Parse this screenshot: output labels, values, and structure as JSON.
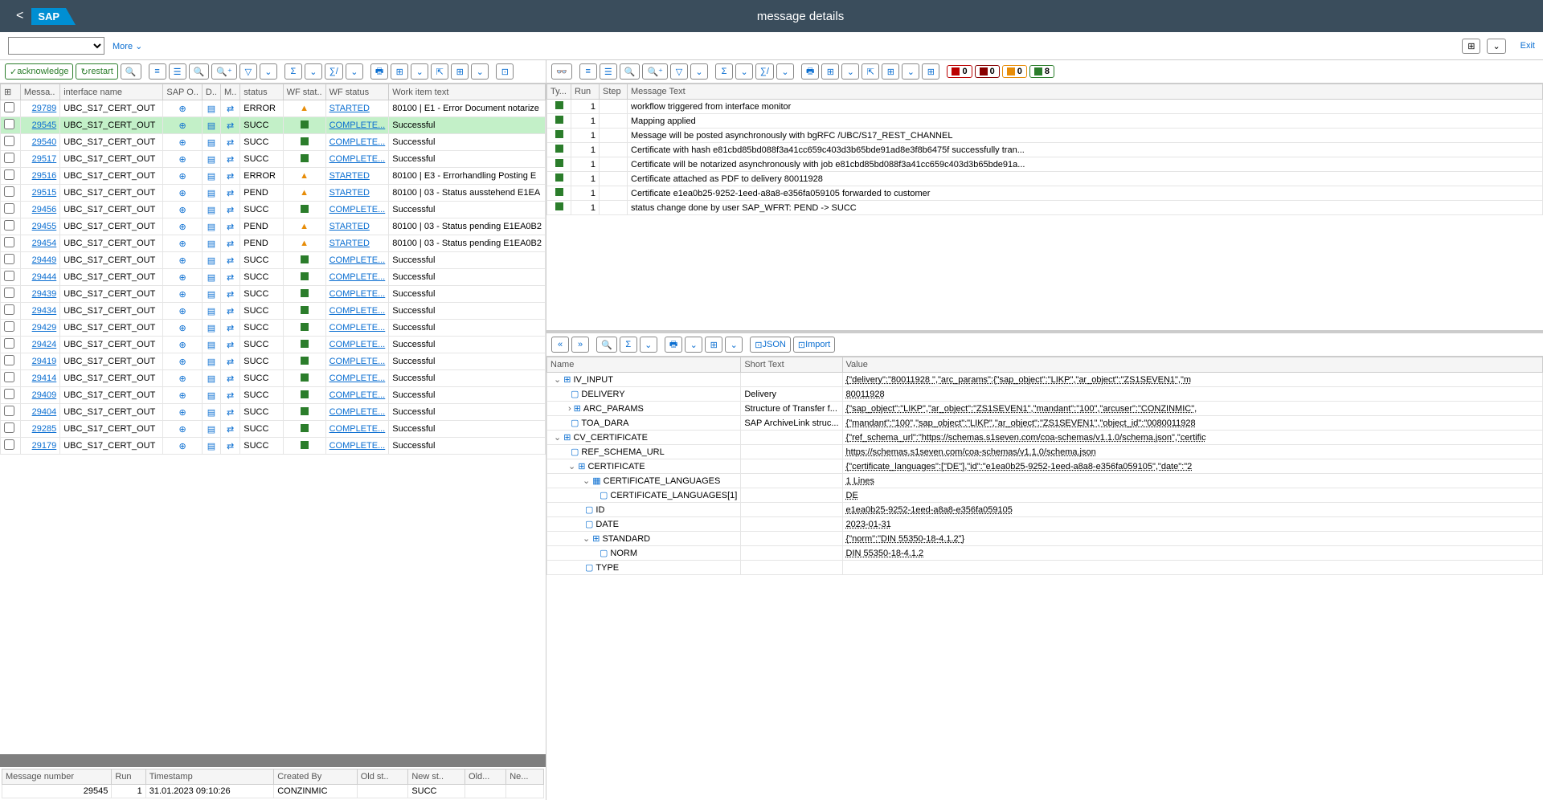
{
  "header": {
    "title": "message details",
    "sap": "SAP",
    "more": "More",
    "exit": "Exit"
  },
  "tb": {
    "ack": "acknowledge",
    "restart": "restart",
    "json": "JSON",
    "import": "Import"
  },
  "badges": {
    "r": "0",
    "dr": "0",
    "o": "0",
    "g": "8"
  },
  "cols_left": [
    "",
    "Messa..",
    "interface name",
    "SAP O..",
    "D..",
    "M..",
    "status",
    "WF stat..",
    "WF status",
    "Work item text"
  ],
  "rows": [
    {
      "id": "29789",
      "if": "UBC_S17_CERT_OUT",
      "st": "ERROR",
      "wfi": "o",
      "wf": "STARTED",
      "txt": "80100 | E1 - Error Document notarize"
    },
    {
      "id": "29545",
      "if": "UBC_S17_CERT_OUT",
      "st": "SUCC",
      "wfi": "g",
      "wf": "COMPLETE...",
      "txt": "Successful",
      "sel": true
    },
    {
      "id": "29540",
      "if": "UBC_S17_CERT_OUT",
      "st": "SUCC",
      "wfi": "g",
      "wf": "COMPLETE...",
      "txt": "Successful"
    },
    {
      "id": "29517",
      "if": "UBC_S17_CERT_OUT",
      "st": "SUCC",
      "wfi": "g",
      "wf": "COMPLETE...",
      "txt": "Successful"
    },
    {
      "id": "29516",
      "if": "UBC_S17_CERT_OUT",
      "st": "ERROR",
      "wfi": "o",
      "wf": "STARTED",
      "txt": "80100 | E3 - Errorhandling Posting E"
    },
    {
      "id": "29515",
      "if": "UBC_S17_CERT_OUT",
      "st": "PEND",
      "wfi": "o",
      "wf": "STARTED",
      "txt": "80100 | 03 - Status ausstehend E1EA"
    },
    {
      "id": "29456",
      "if": "UBC_S17_CERT_OUT",
      "st": "SUCC",
      "wfi": "g",
      "wf": "COMPLETE...",
      "txt": "Successful"
    },
    {
      "id": "29455",
      "if": "UBC_S17_CERT_OUT",
      "st": "PEND",
      "wfi": "o",
      "wf": "STARTED",
      "txt": "80100 | 03 - Status pending E1EA0B2"
    },
    {
      "id": "29454",
      "if": "UBC_S17_CERT_OUT",
      "st": "PEND",
      "wfi": "o",
      "wf": "STARTED",
      "txt": "80100 | 03 - Status pending E1EA0B2"
    },
    {
      "id": "29449",
      "if": "UBC_S17_CERT_OUT",
      "st": "SUCC",
      "wfi": "g",
      "wf": "COMPLETE...",
      "txt": "Successful"
    },
    {
      "id": "29444",
      "if": "UBC_S17_CERT_OUT",
      "st": "SUCC",
      "wfi": "g",
      "wf": "COMPLETE...",
      "txt": "Successful"
    },
    {
      "id": "29439",
      "if": "UBC_S17_CERT_OUT",
      "st": "SUCC",
      "wfi": "g",
      "wf": "COMPLETE...",
      "txt": "Successful"
    },
    {
      "id": "29434",
      "if": "UBC_S17_CERT_OUT",
      "st": "SUCC",
      "wfi": "g",
      "wf": "COMPLETE...",
      "txt": "Successful"
    },
    {
      "id": "29429",
      "if": "UBC_S17_CERT_OUT",
      "st": "SUCC",
      "wfi": "g",
      "wf": "COMPLETE...",
      "txt": "Successful"
    },
    {
      "id": "29424",
      "if": "UBC_S17_CERT_OUT",
      "st": "SUCC",
      "wfi": "g",
      "wf": "COMPLETE...",
      "txt": "Successful"
    },
    {
      "id": "29419",
      "if": "UBC_S17_CERT_OUT",
      "st": "SUCC",
      "wfi": "g",
      "wf": "COMPLETE...",
      "txt": "Successful"
    },
    {
      "id": "29414",
      "if": "UBC_S17_CERT_OUT",
      "st": "SUCC",
      "wfi": "g",
      "wf": "COMPLETE...",
      "txt": "Successful"
    },
    {
      "id": "29409",
      "if": "UBC_S17_CERT_OUT",
      "st": "SUCC",
      "wfi": "g",
      "wf": "COMPLETE...",
      "txt": "Successful"
    },
    {
      "id": "29404",
      "if": "UBC_S17_CERT_OUT",
      "st": "SUCC",
      "wfi": "g",
      "wf": "COMPLETE...",
      "txt": "Successful"
    },
    {
      "id": "29285",
      "if": "UBC_S17_CERT_OUT",
      "st": "SUCC",
      "wfi": "g",
      "wf": "COMPLETE...",
      "txt": "Successful"
    },
    {
      "id": "29179",
      "if": "UBC_S17_CERT_OUT",
      "st": "SUCC",
      "wfi": "g",
      "wf": "COMPLETE...",
      "txt": "Successful"
    }
  ],
  "detail_cols": [
    "Message number",
    "Run",
    "Timestamp",
    "Created By",
    "Old st..",
    "New st..",
    "Old...",
    "Ne..."
  ],
  "detail": {
    "msg": "29545",
    "run": "1",
    "ts": "31.01.2023 09:10:26",
    "by": "CONZINMIC",
    "new": "SUCC"
  },
  "log_cols": [
    "Ty...",
    "Run",
    "Step",
    "Message Text"
  ],
  "log": [
    {
      "r": "1",
      "t": "workflow triggered from interface monitor"
    },
    {
      "r": "1",
      "t": "Mapping applied"
    },
    {
      "r": "1",
      "t": "Message will be posted asynchronously with bgRFC /UBC/S17_REST_CHANNEL"
    },
    {
      "r": "1",
      "t": "Certificate with hash e81cbd85bd088f3a41cc659c403d3b65bde91ad8e3f8b6475f successfully tran..."
    },
    {
      "r": "1",
      "t": "Certificate will be notarized asynchronously with job e81cbd85bd088f3a41cc659c403d3b65bde91a..."
    },
    {
      "r": "1",
      "t": "Certificate attached as PDF to delivery 80011928"
    },
    {
      "r": "1",
      "t": "Certificate e1ea0b25-9252-1eed-a8a8-e356fa059105 forwarded to customer"
    },
    {
      "r": "1",
      "t": "status change done by user SAP_WFRT: PEND -> SUCC"
    }
  ],
  "tree_cols": [
    "Name",
    "Short Text",
    "Value"
  ],
  "tree": [
    {
      "l": 0,
      "e": "v",
      "i": "s",
      "n": "IV_INPUT",
      "s": "",
      "v": "{\"delivery\":\"80011928  \",\"arc_params\":{\"sap_object\":\"LIKP\",\"ar_object\":\"ZS1SEVEN1\",\"m"
    },
    {
      "l": 1,
      "e": "",
      "i": "f",
      "n": "DELIVERY",
      "s": "Delivery",
      "v": "80011928"
    },
    {
      "l": 1,
      "e": ">",
      "i": "s",
      "n": "ARC_PARAMS",
      "s": "Structure of Transfer f...",
      "v": "{\"sap_object\":\"LIKP\",\"ar_object\":\"ZS1SEVEN1\",\"mandant\":\"100\",\"arcuser\":\"CONZINMIC\","
    },
    {
      "l": 1,
      "e": "",
      "i": "f",
      "n": "TOA_DARA",
      "s": "SAP ArchiveLink struc...",
      "v": "{\"mandant\":\"100\",\"sap_object\":\"LIKP\",\"ar_object\":\"ZS1SEVEN1\",\"object_id\":\"0080011928"
    },
    {
      "l": 0,
      "e": "v",
      "i": "s",
      "n": "CV_CERTIFICATE",
      "s": "",
      "v": "{\"ref_schema_url\":\"https://schemas.s1seven.com/coa-schemas/v1.1.0/schema.json\",\"certific"
    },
    {
      "l": 1,
      "e": "",
      "i": "f",
      "n": "REF_SCHEMA_URL",
      "s": "",
      "v": "https://schemas.s1seven.com/coa-schemas/v1.1.0/schema.json"
    },
    {
      "l": 1,
      "e": "v",
      "i": "s",
      "n": "CERTIFICATE",
      "s": "",
      "v": "{\"certificate_languages\":[\"DE\"],\"id\":\"e1ea0b25-9252-1eed-a8a8-e356fa059105\",\"date\":\"2"
    },
    {
      "l": 2,
      "e": "v",
      "i": "t",
      "n": "CERTIFICATE_LANGUAGES",
      "s": "",
      "v": "1 Lines"
    },
    {
      "l": 3,
      "e": "",
      "i": "f",
      "n": "CERTIFICATE_LANGUAGES[1]",
      "s": "",
      "v": "DE"
    },
    {
      "l": 2,
      "e": "",
      "i": "f",
      "n": "ID",
      "s": "",
      "v": "e1ea0b25-9252-1eed-a8a8-e356fa059105"
    },
    {
      "l": 2,
      "e": "",
      "i": "f",
      "n": "DATE",
      "s": "",
      "v": "2023-01-31"
    },
    {
      "l": 2,
      "e": "v",
      "i": "s",
      "n": "STANDARD",
      "s": "",
      "v": "{\"norm\":\"DIN 55350-18-4.1.2\"}"
    },
    {
      "l": 3,
      "e": "",
      "i": "f",
      "n": "NORM",
      "s": "",
      "v": "DIN 55350-18-4.1.2"
    },
    {
      "l": 2,
      "e": "",
      "i": "f",
      "n": "TYPE",
      "s": "",
      "v": ""
    }
  ]
}
